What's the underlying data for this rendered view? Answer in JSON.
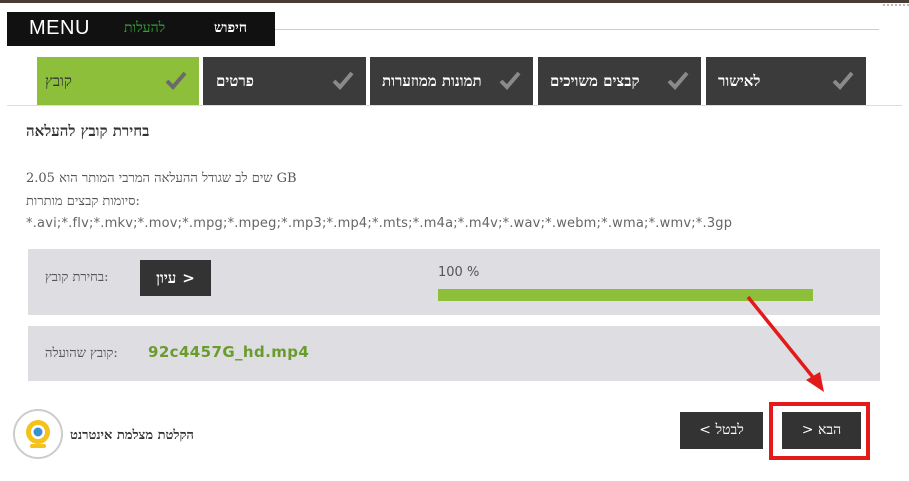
{
  "menu": {
    "menu_label": "MENU",
    "upload_label": "להעלות",
    "search_label": "חיפוש"
  },
  "steps": [
    {
      "label": "קובץ",
      "active": true
    },
    {
      "label": "פרטים",
      "active": false
    },
    {
      "label": "תמונות ממוזערות",
      "active": false
    },
    {
      "label": "קבצים משויכים",
      "active": false
    },
    {
      "label": "לאישור",
      "active": false
    }
  ],
  "panel": {
    "title": "בחירת קובץ להעלאה",
    "max_size_note": "שים לב שגודל ההעלאה המרבי המותר הוא 2.05 GB",
    "allowed_label": "סיומות קבצים מותרות:",
    "allowed_extensions": "*.avi;*.flv;*.mkv;*.mov;*.mpg;*.mpeg;*.mp3;*.mp4;*.mts;*.m4a;*.m4v;*.wav;*.webm;*.wma;*.wmv;*.3gp",
    "choose_file_label": "בחירת קובץ:",
    "browse_label": "עיון",
    "browse_chevron": ">",
    "progress_text": "100 %",
    "progress_value": 1.0,
    "uploaded_label": "קובץ שהועלה:",
    "uploaded_file": "92c4457G_hd.mp4"
  },
  "footer": {
    "webcam_label": "הקלטת מצלמת אינטרנט",
    "cancel_label": "< לבטל",
    "next_label": "> הבא"
  },
  "colors": {
    "accent_green": "#8dbf3a",
    "dark": "#333333",
    "highlight_red": "#e21a1a"
  },
  "icons": {
    "tab_status": "checkmark-icon",
    "webcam": "webcam-icon",
    "annotation": "red-arrow"
  }
}
